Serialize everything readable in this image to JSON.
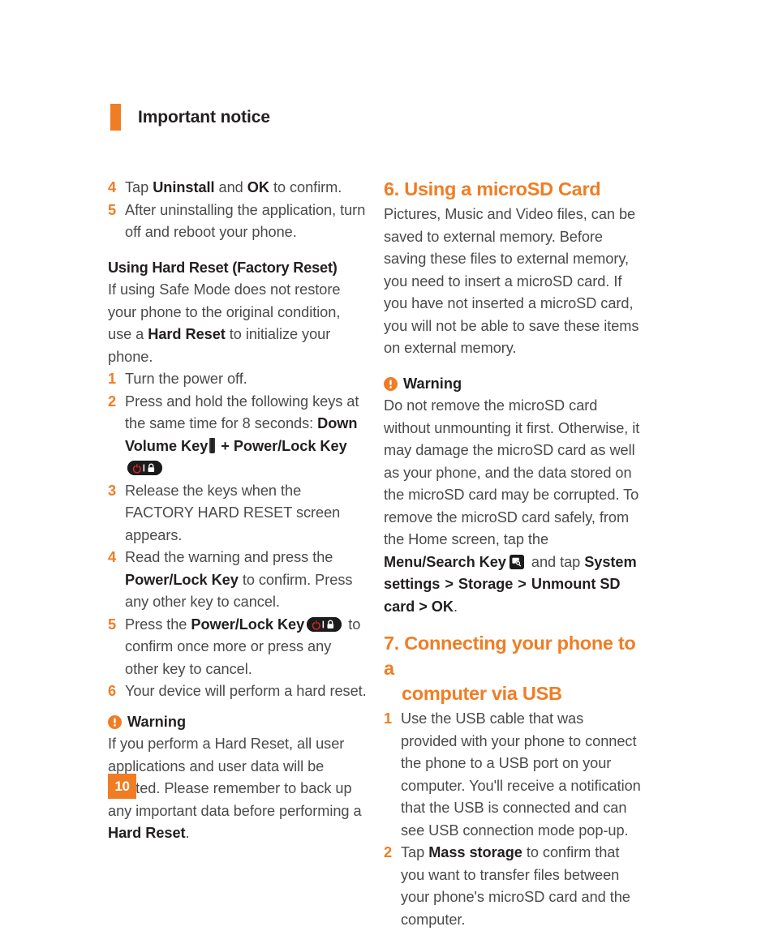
{
  "header": {
    "title": "Important notice"
  },
  "page_number": "10",
  "left_column": {
    "steps_continued": [
      {
        "num": "4",
        "parts": [
          {
            "t": "Tap "
          },
          {
            "t": "Uninstall",
            "b": true
          },
          {
            "t": " and "
          },
          {
            "t": "OK",
            "b": true
          },
          {
            "t": " to confirm."
          }
        ]
      },
      {
        "num": "5",
        "parts": [
          {
            "t": "After uninstalling the application, turn off and reboot your phone."
          }
        ]
      }
    ],
    "subhead": "Using Hard Reset (Factory Reset)",
    "intro_parts": [
      {
        "t": "If using Safe Mode does not restore your phone to the original condition, use a "
      },
      {
        "t": "Hard Reset",
        "b": true
      },
      {
        "t": " to initialize your phone."
      }
    ],
    "hard_reset_steps": [
      {
        "num": "1",
        "parts": [
          {
            "t": "Turn the power off."
          }
        ]
      },
      {
        "num": "2",
        "parts": [
          {
            "t": "Press and hold the following keys at the same time for 8 seconds: "
          },
          {
            "t": "Down Volume Key",
            "b": true
          },
          {
            "icon": "volume-key-icon"
          },
          {
            "t": " + Power/Lock Key ",
            "b": true
          },
          {
            "icon": "power-lock-key-icon"
          }
        ]
      },
      {
        "num": "3",
        "parts": [
          {
            "t": "Release the keys when the FACTORY HARD RESET screen appears."
          }
        ]
      },
      {
        "num": "4",
        "parts": [
          {
            "t": "Read the warning and press the "
          },
          {
            "t": "Power/Lock Key",
            "b": true
          },
          {
            "t": "  to confirm. Press any other key to cancel."
          }
        ]
      },
      {
        "num": "5",
        "parts": [
          {
            "t": "Press the "
          },
          {
            "t": "Power/Lock Key",
            "b": true
          },
          {
            "icon": "power-lock-key-icon"
          },
          {
            "t": " to confirm once more or press any other key to cancel."
          }
        ]
      },
      {
        "num": "6",
        "parts": [
          {
            "t": "Your device will perform a hard reset."
          }
        ]
      }
    ],
    "warning": {
      "label": "Warning",
      "icon": "warning-icon",
      "body_parts": [
        {
          "t": "If you perform a Hard Reset, all user applications and user data will be deleted. Please remember to back up any important data before performing a "
        },
        {
          "t": "Hard Reset",
          "b": true
        },
        {
          "t": "."
        }
      ]
    }
  },
  "right_column": {
    "section6": {
      "heading": "6. Using a microSD Card",
      "body": "Pictures, Music and Video files, can be saved to external memory.  Before saving these files to external memory, you need to insert a microSD card. If you have not inserted a microSD card, you will not be able to save these items on external memory."
    },
    "warning": {
      "label": "Warning",
      "icon": "warning-icon",
      "body_parts": [
        {
          "t": "Do not remove the microSD card without unmounting it first. Otherwise, it may damage the microSD card as well as your phone, and the data stored on the microSD card may be corrupted. To remove the microSD card safely, from the Home screen, tap the "
        },
        {
          "t": "Menu/Search Key",
          "b": true
        },
        {
          "icon": "menu-search-key-icon"
        },
        {
          "t": " and tap "
        },
        {
          "t": "System settings",
          "b": true
        },
        {
          "t": " > ",
          "gt": true
        },
        {
          "t": "Storage",
          "b": true
        },
        {
          "t": " > ",
          "gt": true
        },
        {
          "t": "Unmount SD card > OK",
          "b": true
        },
        {
          "t": "."
        }
      ]
    },
    "section7": {
      "heading_line1": "7. Connecting your phone to a",
      "heading_line2": "computer via USB",
      "steps": [
        {
          "num": "1",
          "parts": [
            {
              "t": "Use the USB cable that was provided with your phone to connect the phone to a USB port on your computer. You'll receive a notification that the USB is connected and can see USB connection mode pop-up."
            }
          ]
        },
        {
          "num": "2",
          "parts": [
            {
              "t": "Tap "
            },
            {
              "t": "Mass storage",
              "b": true
            },
            {
              "t": " to confirm that you want to transfer files between your phone's microSD card and the computer."
            }
          ]
        }
      ]
    }
  },
  "colors": {
    "accent_orange": "#f07d24",
    "body_gray": "#4a4a4a",
    "heading_black": "#231f20",
    "key_black": "#1b1b1b",
    "power_red": "#d8232a"
  }
}
